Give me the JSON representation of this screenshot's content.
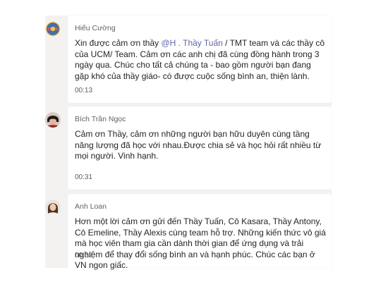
{
  "messages": [
    {
      "author": "Hiếu Cường",
      "text_before_mention": "Xin được cảm ơn thầy ",
      "mention": "@H . Thầy Tuấn",
      "text_after_mention": " / TMT team và các thầy cô của UCM/ Team. Cảm ơn các anh chị đã cùng đồng hành trong 3 ngày qua. Chúc cho tất cả  chúng ta - bao gồm người bạn đang gặp khó của thầy giáo- có được cuộc sống bình an, thiện lành.",
      "time": "00:13"
    },
    {
      "author": "Bích Trần Ngọc",
      "text": "Cảm ơn Thầy, cảm ơn những người bạn hữu duyên cùng tầng năng lượng đã học với nhau.Được chia sẻ và học hỏi rất nhiều từ mọi người. Vinh hạnh.",
      "time": "00:31"
    },
    {
      "author": "Anh Loan",
      "text": "Hơn một lời cảm ơn gửi đến Thầy Tuấn, Cô Kasara, Thầy Antony, Cô Emeline, Thầy Alexis cùng team hỗ trợ. Những kiến thức vô giá mà học viên tham gia cần dành thời gian để ứng dụng và trải nghiệm để thay đổi sống bình an và hạnh phúc. Chúc các bạn ở VN ngon giấc.",
      "time": "00:33"
    }
  ],
  "colors": {
    "panel_bg": "#f3f2f1",
    "bubble_bg": "#ffffff",
    "mention": "#6264a7",
    "text": "#252423",
    "meta": "#616161"
  }
}
